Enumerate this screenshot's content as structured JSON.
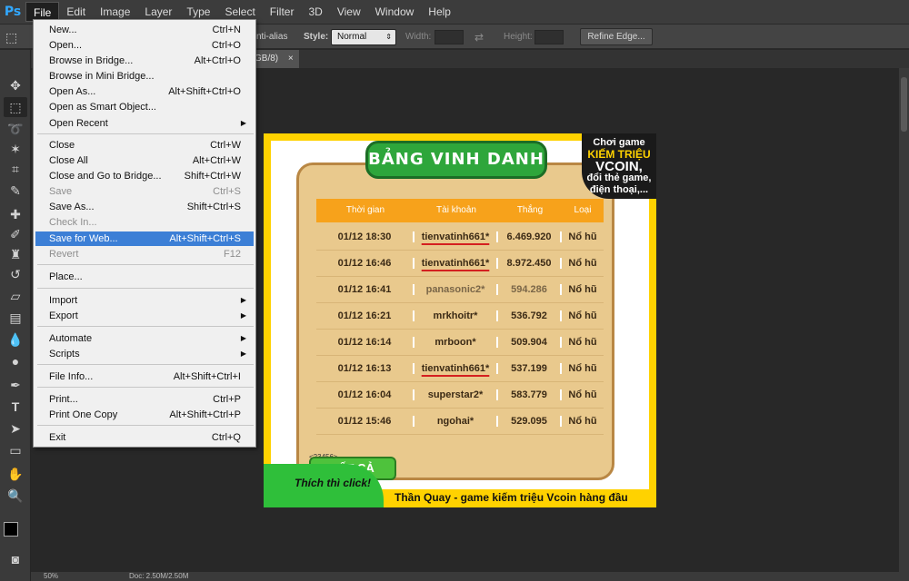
{
  "app": {
    "logo": "Ps"
  },
  "menubar": [
    "File",
    "Edit",
    "Image",
    "Layer",
    "Type",
    "Select",
    "Filter",
    "3D",
    "View",
    "Window",
    "Help"
  ],
  "options": {
    "antialias_label": "nti-alias",
    "style_label": "Style:",
    "style_value": "Normal",
    "width_label": "Width:",
    "height_label": "Height:",
    "refine_edge": "Refine Edge..."
  },
  "document_tab": {
    "label": "GB/8)",
    "close": "×"
  },
  "status": {
    "zoom": "50%",
    "doc": "Doc: 2.50M/2.50M"
  },
  "file_menu": [
    {
      "label": "New...",
      "shortcut": "Ctrl+N"
    },
    {
      "label": "Open...",
      "shortcut": "Ctrl+O"
    },
    {
      "label": "Browse in Bridge...",
      "shortcut": "Alt+Ctrl+O"
    },
    {
      "label": "Browse in Mini Bridge...",
      "shortcut": ""
    },
    {
      "label": "Open As...",
      "shortcut": "Alt+Shift+Ctrl+O"
    },
    {
      "label": "Open as Smart Object...",
      "shortcut": ""
    },
    {
      "label": "Open Recent",
      "shortcut": ""
    },
    {
      "label": "Close",
      "shortcut": "Ctrl+W"
    },
    {
      "label": "Close All",
      "shortcut": "Alt+Ctrl+W"
    },
    {
      "label": "Close and Go to Bridge...",
      "shortcut": "Shift+Ctrl+W"
    },
    {
      "label": "Save",
      "shortcut": "Ctrl+S"
    },
    {
      "label": "Save As...",
      "shortcut": "Shift+Ctrl+S"
    },
    {
      "label": "Check In...",
      "shortcut": ""
    },
    {
      "label": "Save for Web...",
      "shortcut": "Alt+Shift+Ctrl+S"
    },
    {
      "label": "Revert",
      "shortcut": "F12"
    },
    {
      "label": "Place...",
      "shortcut": ""
    },
    {
      "label": "Import",
      "shortcut": ""
    },
    {
      "label": "Export",
      "shortcut": ""
    },
    {
      "label": "Automate",
      "shortcut": ""
    },
    {
      "label": "Scripts",
      "shortcut": ""
    },
    {
      "label": "File Info...",
      "shortcut": "Alt+Shift+Ctrl+I"
    },
    {
      "label": "Print...",
      "shortcut": "Ctrl+P"
    },
    {
      "label": "Print One Copy",
      "shortcut": "Alt+Shift+Ctrl+P"
    },
    {
      "label": "Exit",
      "shortcut": "Ctrl+Q"
    }
  ],
  "banner": {
    "title": "BẢNG VINH DANH",
    "promo_line1": "Chơi game",
    "promo_line2": "KIẾM TRIỆU",
    "promo_line3": "VCOIN,",
    "promo_line4": "đổi thẻ game,",
    "promo_line5": "điện thoại,...",
    "headers": [
      "Thời gian",
      "Tài khoản",
      "Thắng",
      "Loại"
    ],
    "rows": [
      [
        "01/12 18:30",
        "tienvatinh661*",
        "6.469.920",
        "Nổ hũ"
      ],
      [
        "01/12 16:46",
        "tienvatinh661*",
        "8.972.450",
        "Nổ hũ"
      ],
      [
        "01/12 16:41",
        "panasonic2*",
        "594.286",
        "Nổ hũ"
      ],
      [
        "01/12 16:21",
        "mrkhoitr*",
        "536.792",
        "Nổ hũ"
      ],
      [
        "01/12 16:14",
        "mrboon*",
        "509.904",
        "Nổ hũ"
      ],
      [
        "01/12 16:13",
        "tienvatinh661*",
        "537.199",
        "Nổ hũ"
      ],
      [
        "01/12 16:04",
        "superstar2*",
        "583.779",
        "Nổ hũ"
      ],
      [
        "01/12 15:46",
        "ngohai*",
        "529.095",
        "Nổ hũ"
      ]
    ],
    "button_all": "TẤT CẢ",
    "small_badge": "<23456>",
    "click_text": "Thích thì click!",
    "slogan": "Thần Quay - game kiếm triệu Vcoin hàng đầu"
  },
  "colors": {
    "accent": "#31a8ff",
    "menu_highlight": "#3c7fd6"
  }
}
